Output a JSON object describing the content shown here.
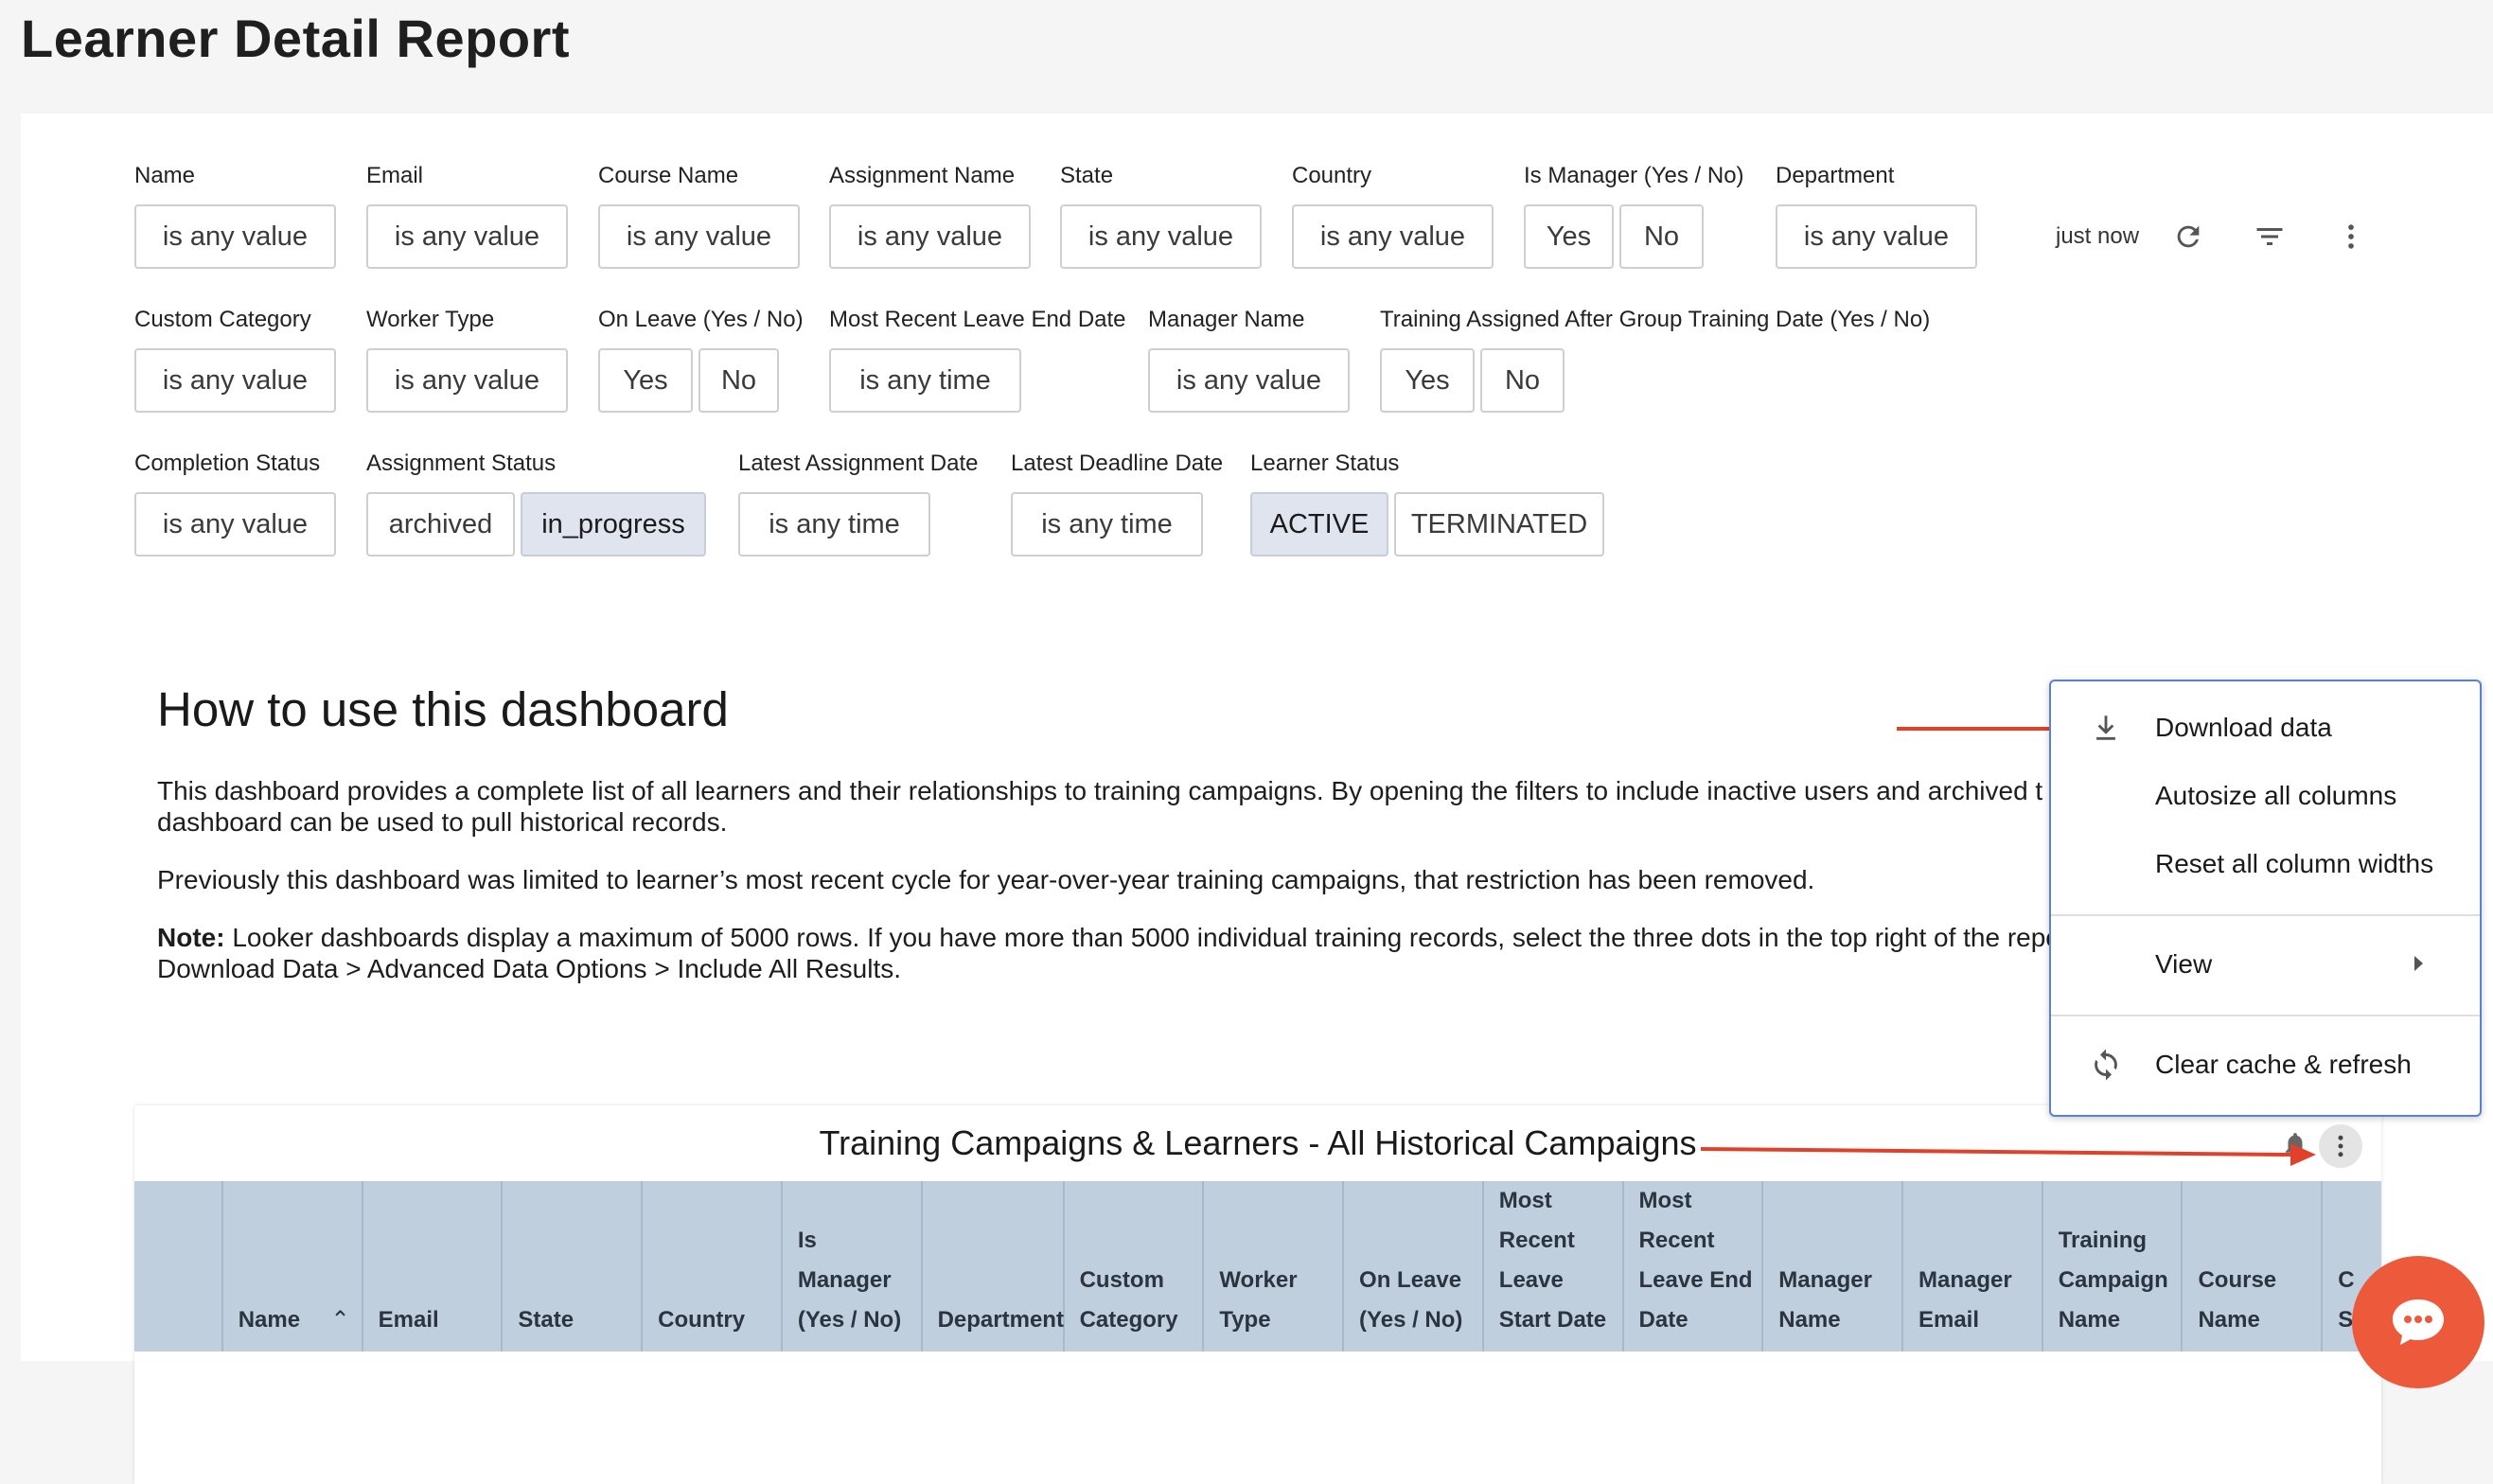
{
  "page": {
    "title": "Learner Detail Report"
  },
  "filters_row1": [
    {
      "label": "Name",
      "chips": [
        "is any value"
      ]
    },
    {
      "label": "Email",
      "chips": [
        "is any value"
      ]
    },
    {
      "label": "Course Name",
      "chips": [
        "is any value"
      ]
    },
    {
      "label": "Assignment Name",
      "chips": [
        "is any value"
      ]
    },
    {
      "label": "State",
      "chips": [
        "is any value"
      ]
    },
    {
      "label": "Country",
      "chips": [
        "is any value"
      ]
    },
    {
      "label": "Is Manager (Yes / No)",
      "chips": [
        "Yes",
        "No"
      ]
    },
    {
      "label": "Department",
      "chips": [
        "is any value"
      ]
    }
  ],
  "filters_row2": [
    {
      "label": "Custom Category",
      "chips": [
        "is any value"
      ]
    },
    {
      "label": "Worker Type",
      "chips": [
        "is any value"
      ]
    },
    {
      "label": "On Leave (Yes / No)",
      "chips": [
        "Yes",
        "No"
      ]
    },
    {
      "label": "Most Recent Leave End Date",
      "chips": [
        "is any time"
      ]
    },
    {
      "label": "Manager Name",
      "chips": [
        "is any value"
      ]
    },
    {
      "label": "Training Assigned After Group Training Date (Yes / No)",
      "chips": [
        "Yes",
        "No"
      ]
    }
  ],
  "filters_row3": [
    {
      "label": "Completion Status",
      "chips": [
        "is any value"
      ]
    },
    {
      "label": "Assignment Status",
      "chips": [
        "archived",
        "in_progress"
      ]
    },
    {
      "label": "Latest Assignment Date",
      "chips": [
        "is any time"
      ]
    },
    {
      "label": "Latest Deadline Date",
      "chips": [
        "is any time"
      ]
    },
    {
      "label": "Learner Status",
      "chips": [
        "ACTIVE",
        "TERMINATED"
      ]
    }
  ],
  "toolbar": {
    "refreshed": "just now",
    "icons": [
      "refresh-icon",
      "filter-icon",
      "more-vert-icon"
    ]
  },
  "info": {
    "heading": "How to use this dashboard",
    "p1": "This dashboard provides a complete list of all learners and their relationships to training campaigns. By opening the filters to include inactive users and archived t",
    "p1b": "dashboard can be used to pull historical records.",
    "p2": "Previously this dashboard was limited to learner’s most recent cycle for year-over-year training campaigns, that restriction has been removed.",
    "note_label": "Note:",
    "p3": " Looker dashboards display a maximum of 5000 rows. If you have more than 5000 individual training records, select the three dots in the top right of the repo",
    "p3b": "Download Data > Advanced Data Options > Include All Results."
  },
  "tile": {
    "title": "Training Campaigns & Learners - All Historical Campaigns",
    "columns": [
      "",
      "Name",
      "Email",
      "State",
      "Country",
      "Is\nManager\n(Yes / No)",
      "Department",
      "Custom\nCategory",
      "Worker\nType",
      "On Leave\n(Yes / No)",
      "Most\nRecent\nLeave\nStart Date",
      "Most\nRecent\nLeave End\nDate",
      "Manager\nName",
      "Manager\nEmail",
      "Training\nCampaign\nName",
      "Course\nName",
      "C\nS"
    ]
  },
  "menu": {
    "items": [
      "Download data",
      "Autosize all columns",
      "Reset all column widths",
      "View",
      "Clear cache & refresh"
    ]
  },
  "colors": {
    "accent": "#5c7fcf",
    "arrow": "#e0412b",
    "chat": "#ec5a3b",
    "header_bg": "#bfcfde",
    "chip_selected": "#e0e4ee"
  }
}
